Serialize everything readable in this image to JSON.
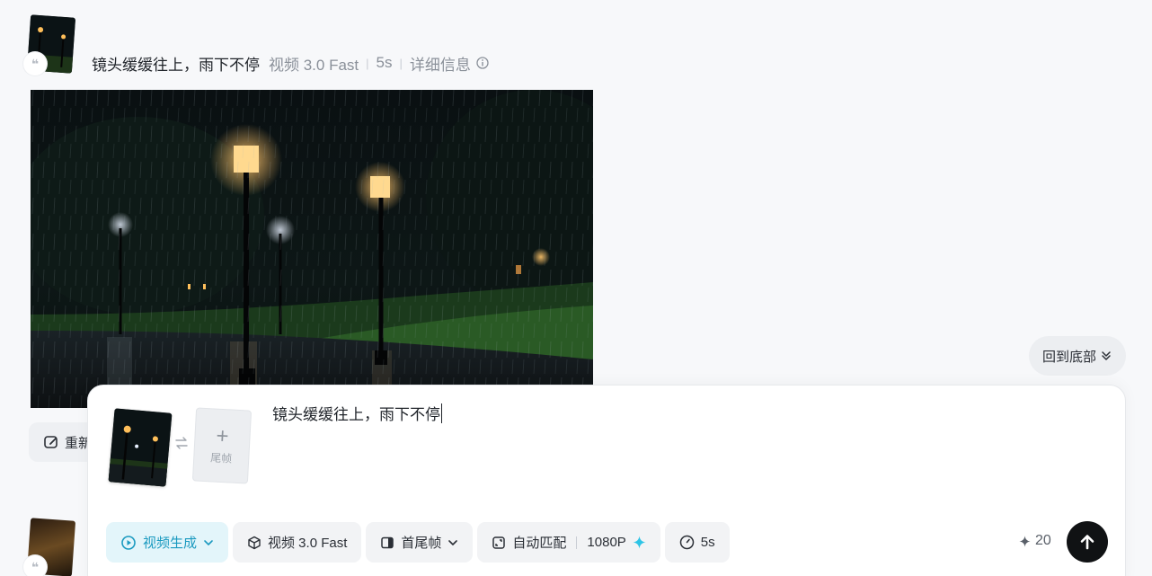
{
  "history": {
    "prompt": "镜头缓缓往上，雨下不停",
    "model": "视频 3.0 Fast",
    "duration": "5s",
    "details_label": "详细信息",
    "quote_glyph": "❝"
  },
  "regenerate_label": "重新",
  "back_to_bottom_label": "回到底部",
  "composer": {
    "prompt_text": "镜头缓缓往上，雨下不停",
    "last_frame_label": "尾帧",
    "last_frame_plus": "+",
    "mode_label": "视频生成",
    "model_label": "视频 3.0 Fast",
    "frames_label": "首尾帧",
    "ratio_label": "自动匹配",
    "resolution_label": "1080P",
    "duration_label": "5s",
    "credits": "20"
  },
  "colors": {
    "accent": "#1b9ac0",
    "accent_bg": "#e3f5fa",
    "lamp_glow": "#ffb347",
    "send_button": "#101214"
  }
}
